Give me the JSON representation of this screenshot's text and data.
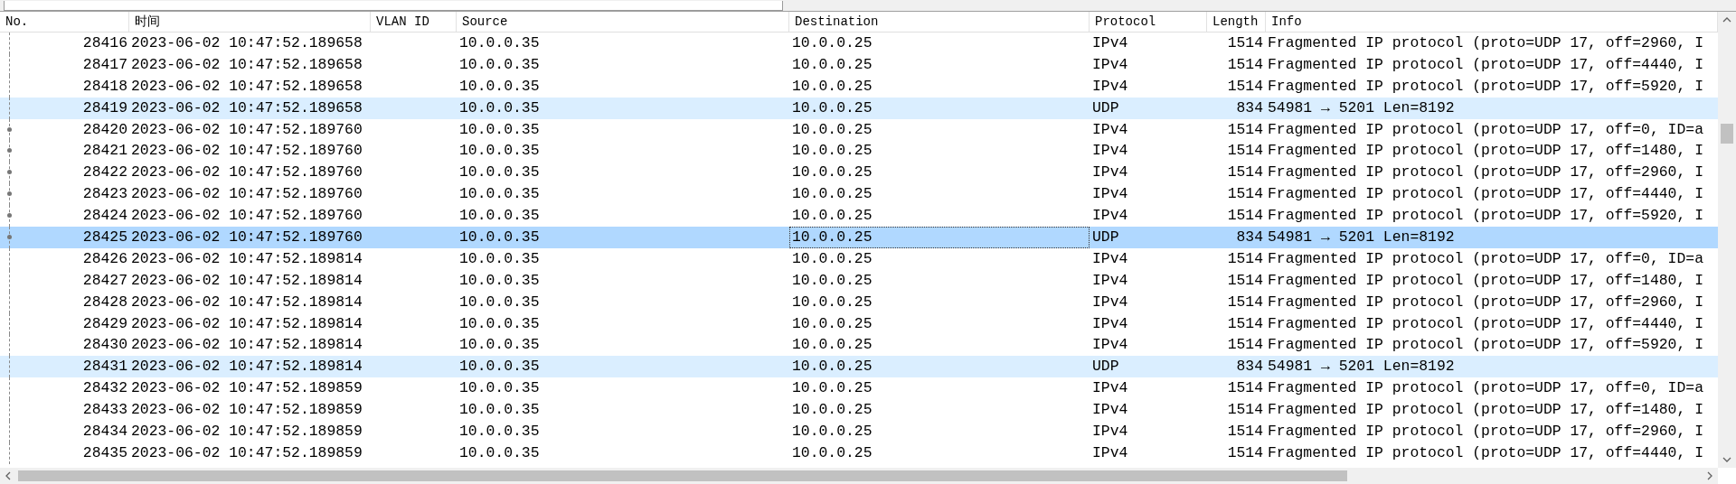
{
  "columns": [
    "No.",
    "时间",
    "VLAN ID",
    "Source",
    "Destination",
    "Protocol",
    "Length",
    "Info"
  ],
  "rows": [
    {
      "no": "28416",
      "time": "2023-06-02 10:47:52.189658",
      "vlan": "",
      "source": "10.0.0.35",
      "destination": "10.0.0.25",
      "protocol": "IPv4",
      "length": "1514",
      "info": "Fragmented IP protocol (proto=UDP 17, off=2960, I",
      "color": "#ffffff",
      "related": false,
      "selected": false
    },
    {
      "no": "28417",
      "time": "2023-06-02 10:47:52.189658",
      "vlan": "",
      "source": "10.0.0.35",
      "destination": "10.0.0.25",
      "protocol": "IPv4",
      "length": "1514",
      "info": "Fragmented IP protocol (proto=UDP 17, off=4440, I",
      "color": "#ffffff",
      "related": false,
      "selected": false
    },
    {
      "no": "28418",
      "time": "2023-06-02 10:47:52.189658",
      "vlan": "",
      "source": "10.0.0.35",
      "destination": "10.0.0.25",
      "protocol": "IPv4",
      "length": "1514",
      "info": "Fragmented IP protocol (proto=UDP 17, off=5920, I",
      "color": "#ffffff",
      "related": false,
      "selected": false
    },
    {
      "no": "28419",
      "time": "2023-06-02 10:47:52.189658",
      "vlan": "",
      "source": "10.0.0.35",
      "destination": "10.0.0.25",
      "protocol": "UDP",
      "length": "834",
      "info": "54981 → 5201 Len=8192",
      "color": "#daeeff",
      "related": false,
      "selected": false
    },
    {
      "no": "28420",
      "time": "2023-06-02 10:47:52.189760",
      "vlan": "",
      "source": "10.0.0.35",
      "destination": "10.0.0.25",
      "protocol": "IPv4",
      "length": "1514",
      "info": "Fragmented IP protocol (proto=UDP 17, off=0, ID=a",
      "color": "#ffffff",
      "related": true,
      "selected": false
    },
    {
      "no": "28421",
      "time": "2023-06-02 10:47:52.189760",
      "vlan": "",
      "source": "10.0.0.35",
      "destination": "10.0.0.25",
      "protocol": "IPv4",
      "length": "1514",
      "info": "Fragmented IP protocol (proto=UDP 17, off=1480, I",
      "color": "#ffffff",
      "related": true,
      "selected": false
    },
    {
      "no": "28422",
      "time": "2023-06-02 10:47:52.189760",
      "vlan": "",
      "source": "10.0.0.35",
      "destination": "10.0.0.25",
      "protocol": "IPv4",
      "length": "1514",
      "info": "Fragmented IP protocol (proto=UDP 17, off=2960, I",
      "color": "#ffffff",
      "related": true,
      "selected": false
    },
    {
      "no": "28423",
      "time": "2023-06-02 10:47:52.189760",
      "vlan": "",
      "source": "10.0.0.35",
      "destination": "10.0.0.25",
      "protocol": "IPv4",
      "length": "1514",
      "info": "Fragmented IP protocol (proto=UDP 17, off=4440, I",
      "color": "#ffffff",
      "related": true,
      "selected": false
    },
    {
      "no": "28424",
      "time": "2023-06-02 10:47:52.189760",
      "vlan": "",
      "source": "10.0.0.35",
      "destination": "10.0.0.25",
      "protocol": "IPv4",
      "length": "1514",
      "info": "Fragmented IP protocol (proto=UDP 17, off=5920, I",
      "color": "#ffffff",
      "related": true,
      "selected": false
    },
    {
      "no": "28425",
      "time": "2023-06-02 10:47:52.189760",
      "vlan": "",
      "source": "10.0.0.35",
      "destination": "10.0.0.25",
      "protocol": "UDP",
      "length": "834",
      "info": "54981 → 5201 Len=8192",
      "color": "#b0d8ff",
      "related": true,
      "selected": true
    },
    {
      "no": "28426",
      "time": "2023-06-02 10:47:52.189814",
      "vlan": "",
      "source": "10.0.0.35",
      "destination": "10.0.0.25",
      "protocol": "IPv4",
      "length": "1514",
      "info": "Fragmented IP protocol (proto=UDP 17, off=0, ID=a",
      "color": "#ffffff",
      "related": false,
      "selected": false
    },
    {
      "no": "28427",
      "time": "2023-06-02 10:47:52.189814",
      "vlan": "",
      "source": "10.0.0.35",
      "destination": "10.0.0.25",
      "protocol": "IPv4",
      "length": "1514",
      "info": "Fragmented IP protocol (proto=UDP 17, off=1480, I",
      "color": "#ffffff",
      "related": false,
      "selected": false
    },
    {
      "no": "28428",
      "time": "2023-06-02 10:47:52.189814",
      "vlan": "",
      "source": "10.0.0.35",
      "destination": "10.0.0.25",
      "protocol": "IPv4",
      "length": "1514",
      "info": "Fragmented IP protocol (proto=UDP 17, off=2960, I",
      "color": "#ffffff",
      "related": false,
      "selected": false
    },
    {
      "no": "28429",
      "time": "2023-06-02 10:47:52.189814",
      "vlan": "",
      "source": "10.0.0.35",
      "destination": "10.0.0.25",
      "protocol": "IPv4",
      "length": "1514",
      "info": "Fragmented IP protocol (proto=UDP 17, off=4440, I",
      "color": "#ffffff",
      "related": false,
      "selected": false
    },
    {
      "no": "28430",
      "time": "2023-06-02 10:47:52.189814",
      "vlan": "",
      "source": "10.0.0.35",
      "destination": "10.0.0.25",
      "protocol": "IPv4",
      "length": "1514",
      "info": "Fragmented IP protocol (proto=UDP 17, off=5920, I",
      "color": "#ffffff",
      "related": false,
      "selected": false
    },
    {
      "no": "28431",
      "time": "2023-06-02 10:47:52.189814",
      "vlan": "",
      "source": "10.0.0.35",
      "destination": "10.0.0.25",
      "protocol": "UDP",
      "length": "834",
      "info": "54981 → 5201 Len=8192",
      "color": "#daeeff",
      "related": false,
      "selected": false
    },
    {
      "no": "28432",
      "time": "2023-06-02 10:47:52.189859",
      "vlan": "",
      "source": "10.0.0.35",
      "destination": "10.0.0.25",
      "protocol": "IPv4",
      "length": "1514",
      "info": "Fragmented IP protocol (proto=UDP 17, off=0, ID=a",
      "color": "#ffffff",
      "related": false,
      "selected": false
    },
    {
      "no": "28433",
      "time": "2023-06-02 10:47:52.189859",
      "vlan": "",
      "source": "10.0.0.35",
      "destination": "10.0.0.25",
      "protocol": "IPv4",
      "length": "1514",
      "info": "Fragmented IP protocol (proto=UDP 17, off=1480, I",
      "color": "#ffffff",
      "related": false,
      "selected": false
    },
    {
      "no": "28434",
      "time": "2023-06-02 10:47:52.189859",
      "vlan": "",
      "source": "10.0.0.35",
      "destination": "10.0.0.25",
      "protocol": "IPv4",
      "length": "1514",
      "info": "Fragmented IP protocol (proto=UDP 17, off=2960, I",
      "color": "#ffffff",
      "related": false,
      "selected": false
    },
    {
      "no": "28435",
      "time": "2023-06-02 10:47:52.189859",
      "vlan": "",
      "source": "10.0.0.35",
      "destination": "10.0.0.25",
      "protocol": "IPv4",
      "length": "1514",
      "info": "Fragmented IP protocol (proto=UDP 17, off=4440, I",
      "color": "#ffffff",
      "related": false,
      "selected": false
    }
  ]
}
